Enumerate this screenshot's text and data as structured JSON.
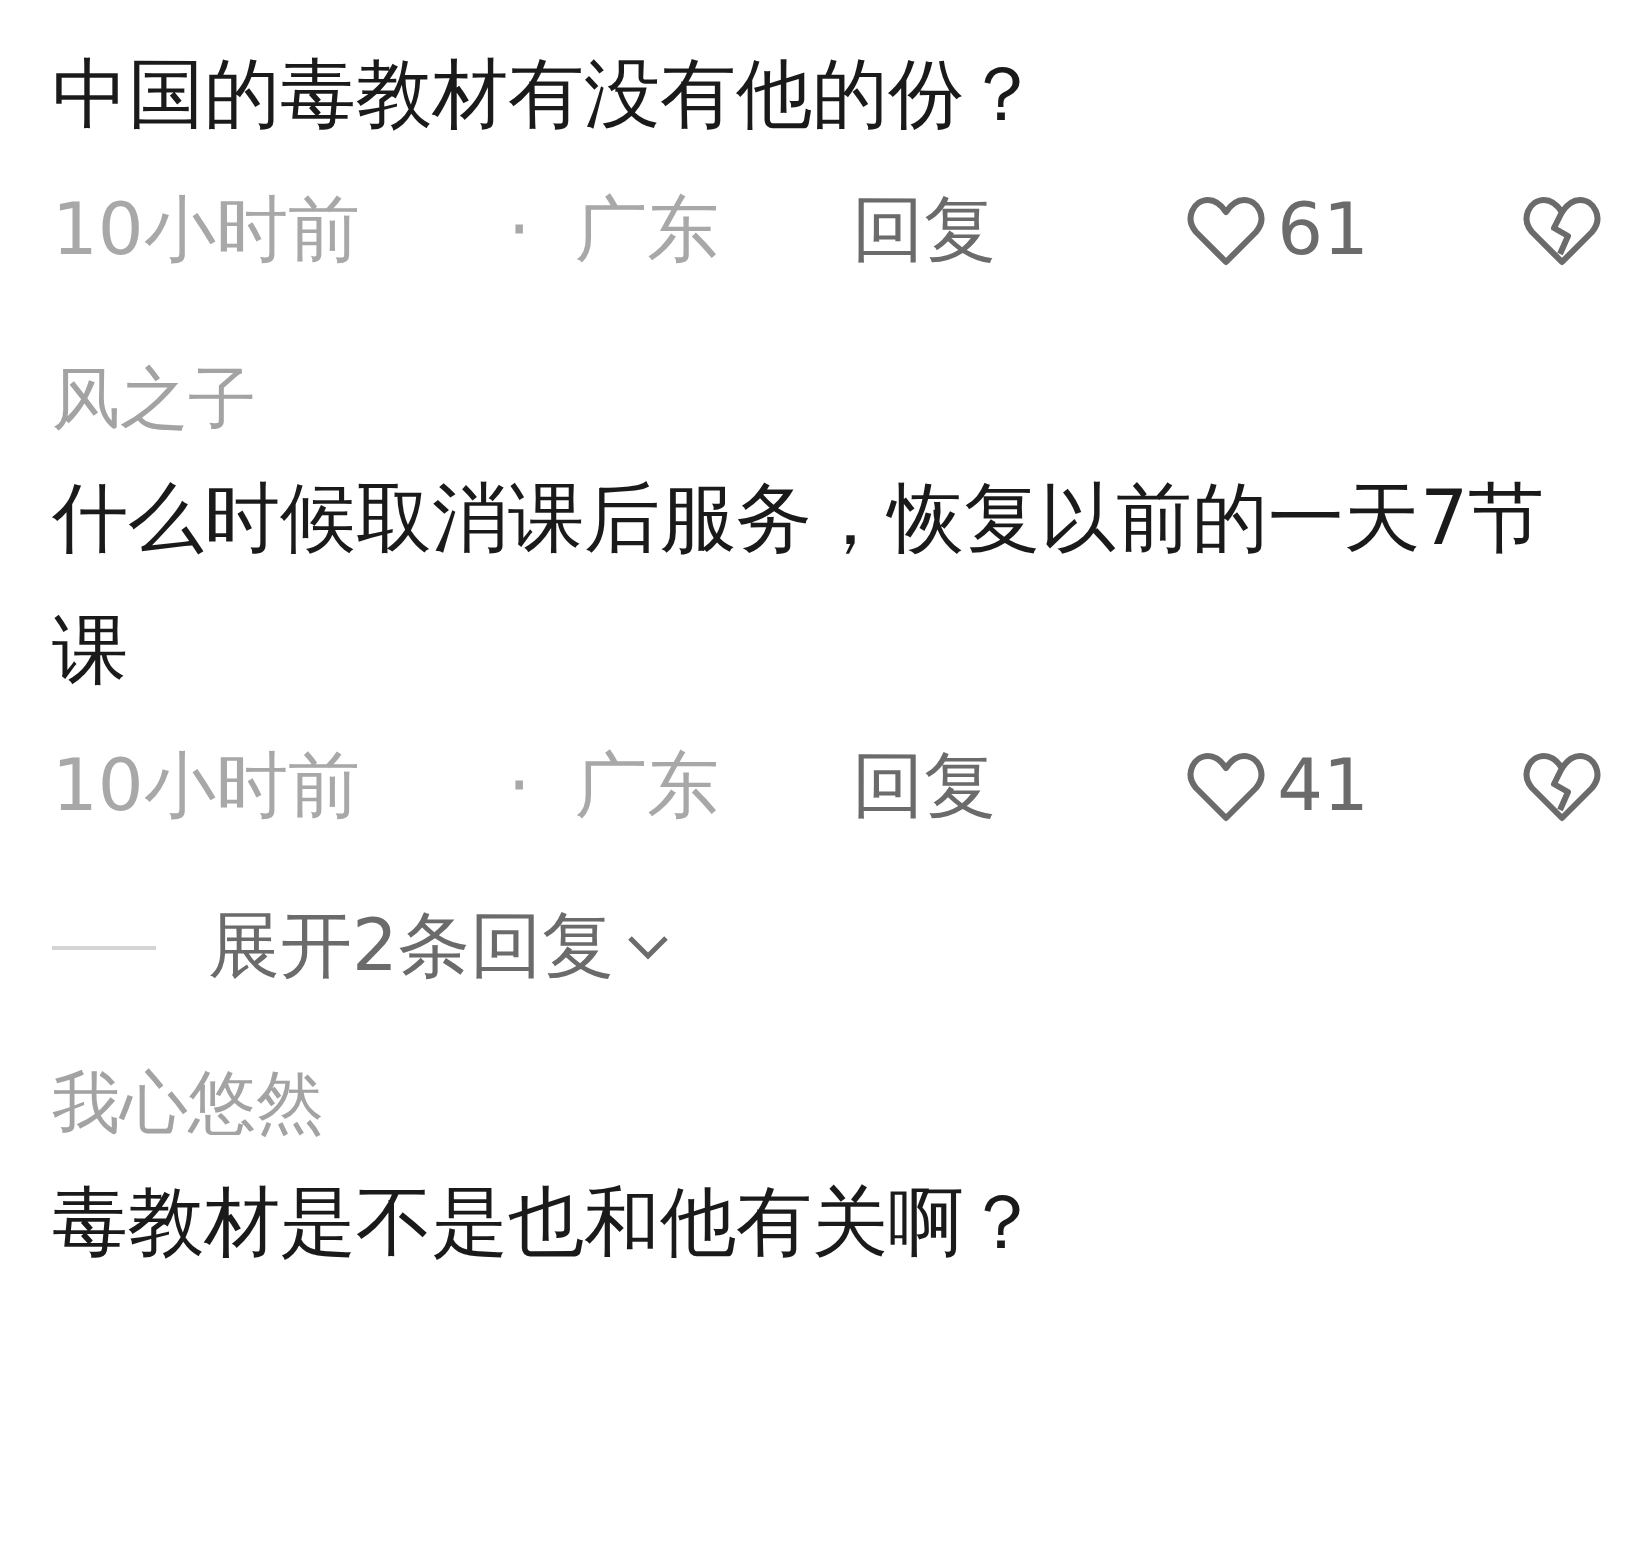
{
  "comments": [
    {
      "text": "中国的毒教材有没有他的份？",
      "meta": {
        "time": "10小时前",
        "separator": "·",
        "location": "广东",
        "reply": "回复",
        "likes": "61"
      }
    },
    {
      "username": "风之子",
      "text": "什么时候取消课后服务，恢复以前的一天7节课",
      "meta": {
        "time": "10小时前",
        "separator": "·",
        "location": "广东",
        "reply": "回复",
        "likes": "41"
      },
      "expand_replies": "展开2条回复"
    },
    {
      "username": "我心悠然",
      "text": "毒教材是不是也和他有关啊？"
    }
  ]
}
